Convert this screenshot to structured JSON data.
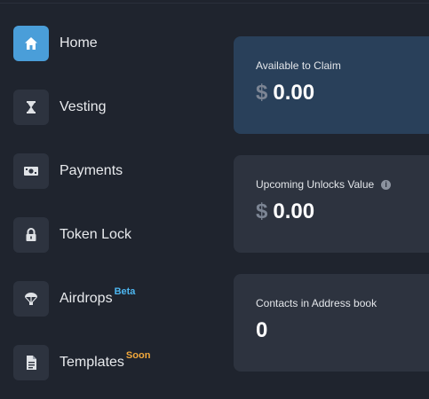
{
  "sidebar": {
    "items": [
      {
        "label": "Home",
        "icon": "home-icon",
        "active": true
      },
      {
        "label": "Vesting",
        "icon": "hourglass-icon"
      },
      {
        "label": "Payments",
        "icon": "cash-icon"
      },
      {
        "label": "Token Lock",
        "icon": "lock-icon"
      },
      {
        "label": "Airdrops",
        "icon": "parachute-icon",
        "badge": "Beta"
      },
      {
        "label": "Templates",
        "icon": "document-icon",
        "badge": "Soon"
      }
    ]
  },
  "cards": [
    {
      "title": "Available to Claim",
      "currency": "$",
      "value": "0.00"
    },
    {
      "title": "Upcoming Unlocks Value",
      "currency": "$",
      "value": "0.00",
      "info_icon": "i"
    },
    {
      "title": "Contacts in Address book",
      "value": "0"
    }
  ],
  "colors": {
    "background": "#1f242e",
    "card": "#2d333f",
    "card_highlight": "#29405a",
    "accent": "#4a9ed9",
    "beta": "#4db6f0",
    "soon": "#f2a83b"
  }
}
